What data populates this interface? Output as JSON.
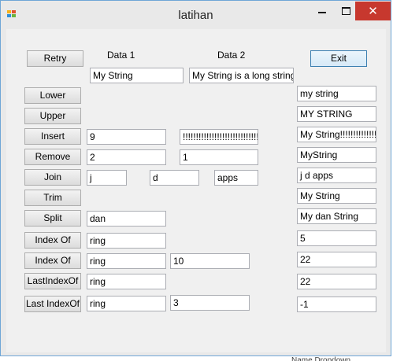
{
  "window": {
    "title": "latihan",
    "close_glyph": "✕",
    "icon_colors": [
      "#f6b21b",
      "#e0542e",
      "#2f8fd8",
      "#6bb43b"
    ]
  },
  "buttons": {
    "retry": "Retry",
    "exit": "Exit",
    "lower": "Lower",
    "upper": "Upper",
    "insert": "Insert",
    "remove": "Remove",
    "join": "Join",
    "trim": "Trim",
    "split": "Split",
    "index_of_1": "Index Of",
    "index_of_2": "Index Of",
    "last_index_of_1": "LastIndexOf",
    "last_index_of_2": "Last IndexOf"
  },
  "labels": {
    "data1": "Data 1",
    "data2": "Data 2"
  },
  "inputs": {
    "data1": "My String",
    "data2": "My String is a long string",
    "insert_pos": "9",
    "insert_text": "!!!!!!!!!!!!!!!!!!!!!!!!!!!!!!!",
    "remove_start": "2",
    "remove_count": "1",
    "join_1": "j",
    "join_2": "d",
    "join_3": "apps",
    "split_text": "dan",
    "indexof1_text": "ring",
    "indexof2_text": "ring",
    "indexof2_start": "10",
    "lastindexof1_text": "ring",
    "lastindexof2_text": "ring",
    "lastindexof2_start": "3"
  },
  "results": {
    "lower": "my string",
    "upper": "MY STRING",
    "insert": "My String!!!!!!!!!!!!!!!!!!!!!!!!!!!!!!!",
    "remove": "MyString",
    "join": "j d apps",
    "trim": "My String",
    "split": "My dan String",
    "index_of_1": "5",
    "index_of_2": "22",
    "last_index_of_1": "22",
    "last_index_of_2": "-1"
  },
  "background_peek_text": "Name  Dropdown"
}
